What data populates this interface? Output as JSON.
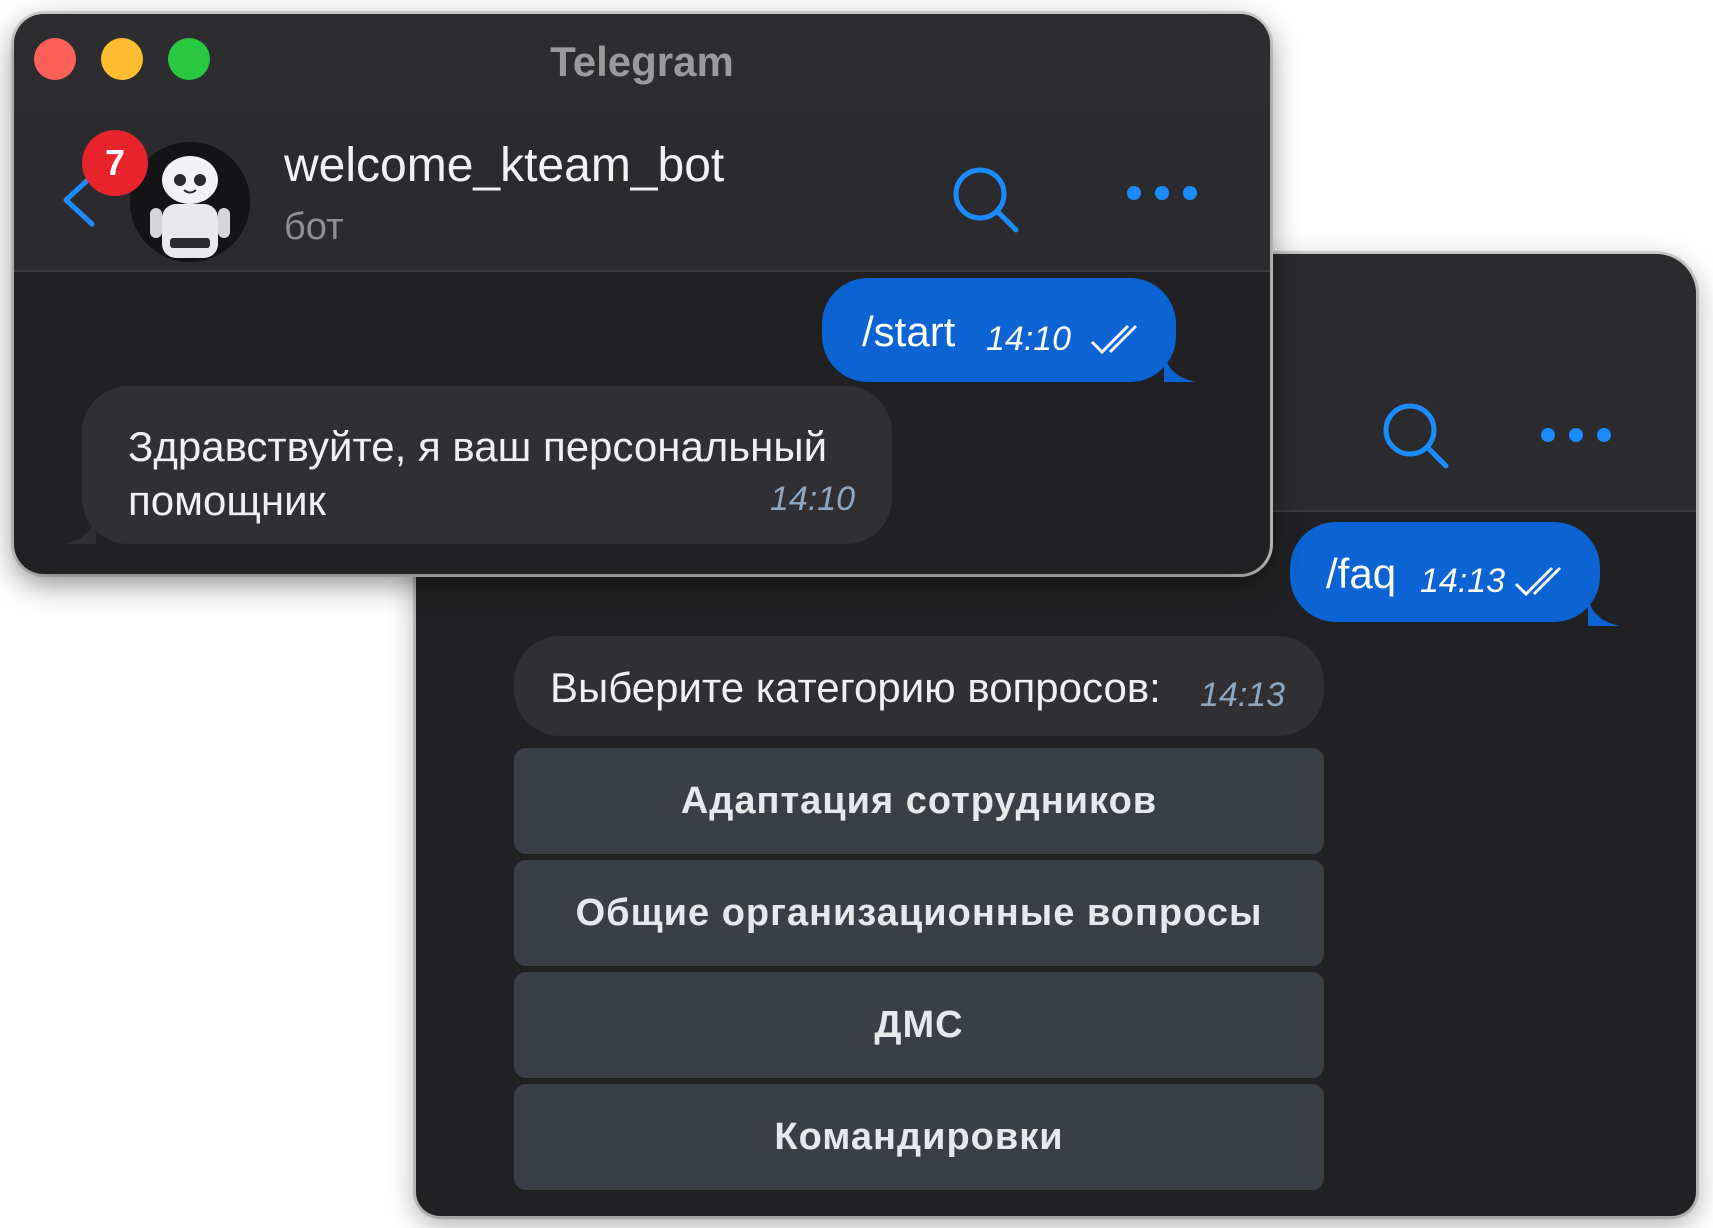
{
  "window": {
    "title": "Telegram"
  },
  "chat": {
    "name": "welcome_kteam_bot",
    "subtitle": "бот",
    "unread_badge": "7"
  },
  "messages": [
    {
      "direction": "out",
      "text": "/start",
      "time": "14:10",
      "status": "read"
    },
    {
      "direction": "in",
      "text": "Здравствуйте, я ваш персональный помощник",
      "time": "14:10"
    },
    {
      "direction": "out",
      "text": "/faq",
      "time": "14:13",
      "status": "read"
    },
    {
      "direction": "in",
      "text": "Выберите категорию вопросов:",
      "time": "14:13"
    }
  ],
  "keyboard": {
    "buttons": [
      "Адаптация сотрудников",
      "Общие организационные вопросы",
      "ДМС",
      "Командировки"
    ]
  },
  "icons": {
    "back": "chevron-left-icon",
    "search": "search-icon",
    "more": "more-icon",
    "read_status": "double-check-icon"
  },
  "colors": {
    "accent": "#0b63d4",
    "badge": "#e8232b",
    "background": "#212123",
    "incoming_bubble": "#303034",
    "keyboard_button": "#3a3f47"
  }
}
